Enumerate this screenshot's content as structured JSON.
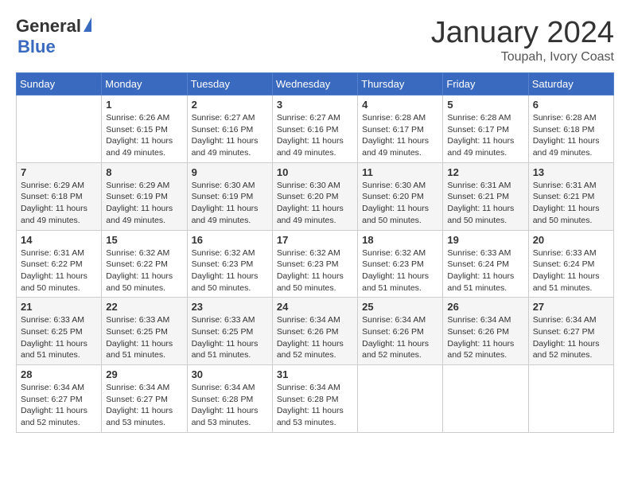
{
  "header": {
    "logo_general": "General",
    "logo_blue": "Blue",
    "month_title": "January 2024",
    "subtitle": "Toupah, Ivory Coast"
  },
  "weekdays": [
    "Sunday",
    "Monday",
    "Tuesday",
    "Wednesday",
    "Thursday",
    "Friday",
    "Saturday"
  ],
  "weeks": [
    [
      {
        "day": "",
        "info": ""
      },
      {
        "day": "1",
        "info": "Sunrise: 6:26 AM\nSunset: 6:15 PM\nDaylight: 11 hours and 49 minutes."
      },
      {
        "day": "2",
        "info": "Sunrise: 6:27 AM\nSunset: 6:16 PM\nDaylight: 11 hours and 49 minutes."
      },
      {
        "day": "3",
        "info": "Sunrise: 6:27 AM\nSunset: 6:16 PM\nDaylight: 11 hours and 49 minutes."
      },
      {
        "day": "4",
        "info": "Sunrise: 6:28 AM\nSunset: 6:17 PM\nDaylight: 11 hours and 49 minutes."
      },
      {
        "day": "5",
        "info": "Sunrise: 6:28 AM\nSunset: 6:17 PM\nDaylight: 11 hours and 49 minutes."
      },
      {
        "day": "6",
        "info": "Sunrise: 6:28 AM\nSunset: 6:18 PM\nDaylight: 11 hours and 49 minutes."
      }
    ],
    [
      {
        "day": "7",
        "info": "Sunrise: 6:29 AM\nSunset: 6:18 PM\nDaylight: 11 hours and 49 minutes."
      },
      {
        "day": "8",
        "info": "Sunrise: 6:29 AM\nSunset: 6:19 PM\nDaylight: 11 hours and 49 minutes."
      },
      {
        "day": "9",
        "info": "Sunrise: 6:30 AM\nSunset: 6:19 PM\nDaylight: 11 hours and 49 minutes."
      },
      {
        "day": "10",
        "info": "Sunrise: 6:30 AM\nSunset: 6:20 PM\nDaylight: 11 hours and 49 minutes."
      },
      {
        "day": "11",
        "info": "Sunrise: 6:30 AM\nSunset: 6:20 PM\nDaylight: 11 hours and 50 minutes."
      },
      {
        "day": "12",
        "info": "Sunrise: 6:31 AM\nSunset: 6:21 PM\nDaylight: 11 hours and 50 minutes."
      },
      {
        "day": "13",
        "info": "Sunrise: 6:31 AM\nSunset: 6:21 PM\nDaylight: 11 hours and 50 minutes."
      }
    ],
    [
      {
        "day": "14",
        "info": "Sunrise: 6:31 AM\nSunset: 6:22 PM\nDaylight: 11 hours and 50 minutes."
      },
      {
        "day": "15",
        "info": "Sunrise: 6:32 AM\nSunset: 6:22 PM\nDaylight: 11 hours and 50 minutes."
      },
      {
        "day": "16",
        "info": "Sunrise: 6:32 AM\nSunset: 6:23 PM\nDaylight: 11 hours and 50 minutes."
      },
      {
        "day": "17",
        "info": "Sunrise: 6:32 AM\nSunset: 6:23 PM\nDaylight: 11 hours and 50 minutes."
      },
      {
        "day": "18",
        "info": "Sunrise: 6:32 AM\nSunset: 6:23 PM\nDaylight: 11 hours and 51 minutes."
      },
      {
        "day": "19",
        "info": "Sunrise: 6:33 AM\nSunset: 6:24 PM\nDaylight: 11 hours and 51 minutes."
      },
      {
        "day": "20",
        "info": "Sunrise: 6:33 AM\nSunset: 6:24 PM\nDaylight: 11 hours and 51 minutes."
      }
    ],
    [
      {
        "day": "21",
        "info": "Sunrise: 6:33 AM\nSunset: 6:25 PM\nDaylight: 11 hours and 51 minutes."
      },
      {
        "day": "22",
        "info": "Sunrise: 6:33 AM\nSunset: 6:25 PM\nDaylight: 11 hours and 51 minutes."
      },
      {
        "day": "23",
        "info": "Sunrise: 6:33 AM\nSunset: 6:25 PM\nDaylight: 11 hours and 51 minutes."
      },
      {
        "day": "24",
        "info": "Sunrise: 6:34 AM\nSunset: 6:26 PM\nDaylight: 11 hours and 52 minutes."
      },
      {
        "day": "25",
        "info": "Sunrise: 6:34 AM\nSunset: 6:26 PM\nDaylight: 11 hours and 52 minutes."
      },
      {
        "day": "26",
        "info": "Sunrise: 6:34 AM\nSunset: 6:26 PM\nDaylight: 11 hours and 52 minutes."
      },
      {
        "day": "27",
        "info": "Sunrise: 6:34 AM\nSunset: 6:27 PM\nDaylight: 11 hours and 52 minutes."
      }
    ],
    [
      {
        "day": "28",
        "info": "Sunrise: 6:34 AM\nSunset: 6:27 PM\nDaylight: 11 hours and 52 minutes."
      },
      {
        "day": "29",
        "info": "Sunrise: 6:34 AM\nSunset: 6:27 PM\nDaylight: 11 hours and 53 minutes."
      },
      {
        "day": "30",
        "info": "Sunrise: 6:34 AM\nSunset: 6:28 PM\nDaylight: 11 hours and 53 minutes."
      },
      {
        "day": "31",
        "info": "Sunrise: 6:34 AM\nSunset: 6:28 PM\nDaylight: 11 hours and 53 minutes."
      },
      {
        "day": "",
        "info": ""
      },
      {
        "day": "",
        "info": ""
      },
      {
        "day": "",
        "info": ""
      }
    ]
  ]
}
